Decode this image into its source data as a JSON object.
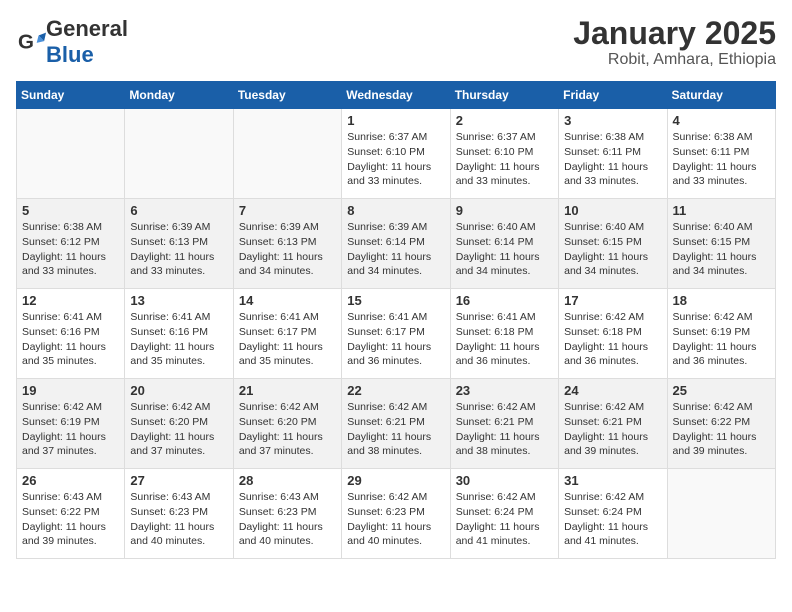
{
  "logo": {
    "general": "General",
    "blue": "Blue"
  },
  "title": "January 2025",
  "subtitle": "Robit, Amhara, Ethiopia",
  "days_of_week": [
    "Sunday",
    "Monday",
    "Tuesday",
    "Wednesday",
    "Thursday",
    "Friday",
    "Saturday"
  ],
  "weeks": [
    [
      {
        "day": "",
        "info": ""
      },
      {
        "day": "",
        "info": ""
      },
      {
        "day": "",
        "info": ""
      },
      {
        "day": "1",
        "info": "Sunrise: 6:37 AM\nSunset: 6:10 PM\nDaylight: 11 hours\nand 33 minutes."
      },
      {
        "day": "2",
        "info": "Sunrise: 6:37 AM\nSunset: 6:10 PM\nDaylight: 11 hours\nand 33 minutes."
      },
      {
        "day": "3",
        "info": "Sunrise: 6:38 AM\nSunset: 6:11 PM\nDaylight: 11 hours\nand 33 minutes."
      },
      {
        "day": "4",
        "info": "Sunrise: 6:38 AM\nSunset: 6:11 PM\nDaylight: 11 hours\nand 33 minutes."
      }
    ],
    [
      {
        "day": "5",
        "info": "Sunrise: 6:38 AM\nSunset: 6:12 PM\nDaylight: 11 hours\nand 33 minutes."
      },
      {
        "day": "6",
        "info": "Sunrise: 6:39 AM\nSunset: 6:13 PM\nDaylight: 11 hours\nand 33 minutes."
      },
      {
        "day": "7",
        "info": "Sunrise: 6:39 AM\nSunset: 6:13 PM\nDaylight: 11 hours\nand 34 minutes."
      },
      {
        "day": "8",
        "info": "Sunrise: 6:39 AM\nSunset: 6:14 PM\nDaylight: 11 hours\nand 34 minutes."
      },
      {
        "day": "9",
        "info": "Sunrise: 6:40 AM\nSunset: 6:14 PM\nDaylight: 11 hours\nand 34 minutes."
      },
      {
        "day": "10",
        "info": "Sunrise: 6:40 AM\nSunset: 6:15 PM\nDaylight: 11 hours\nand 34 minutes."
      },
      {
        "day": "11",
        "info": "Sunrise: 6:40 AM\nSunset: 6:15 PM\nDaylight: 11 hours\nand 34 minutes."
      }
    ],
    [
      {
        "day": "12",
        "info": "Sunrise: 6:41 AM\nSunset: 6:16 PM\nDaylight: 11 hours\nand 35 minutes."
      },
      {
        "day": "13",
        "info": "Sunrise: 6:41 AM\nSunset: 6:16 PM\nDaylight: 11 hours\nand 35 minutes."
      },
      {
        "day": "14",
        "info": "Sunrise: 6:41 AM\nSunset: 6:17 PM\nDaylight: 11 hours\nand 35 minutes."
      },
      {
        "day": "15",
        "info": "Sunrise: 6:41 AM\nSunset: 6:17 PM\nDaylight: 11 hours\nand 36 minutes."
      },
      {
        "day": "16",
        "info": "Sunrise: 6:41 AM\nSunset: 6:18 PM\nDaylight: 11 hours\nand 36 minutes."
      },
      {
        "day": "17",
        "info": "Sunrise: 6:42 AM\nSunset: 6:18 PM\nDaylight: 11 hours\nand 36 minutes."
      },
      {
        "day": "18",
        "info": "Sunrise: 6:42 AM\nSunset: 6:19 PM\nDaylight: 11 hours\nand 36 minutes."
      }
    ],
    [
      {
        "day": "19",
        "info": "Sunrise: 6:42 AM\nSunset: 6:19 PM\nDaylight: 11 hours\nand 37 minutes."
      },
      {
        "day": "20",
        "info": "Sunrise: 6:42 AM\nSunset: 6:20 PM\nDaylight: 11 hours\nand 37 minutes."
      },
      {
        "day": "21",
        "info": "Sunrise: 6:42 AM\nSunset: 6:20 PM\nDaylight: 11 hours\nand 37 minutes."
      },
      {
        "day": "22",
        "info": "Sunrise: 6:42 AM\nSunset: 6:21 PM\nDaylight: 11 hours\nand 38 minutes."
      },
      {
        "day": "23",
        "info": "Sunrise: 6:42 AM\nSunset: 6:21 PM\nDaylight: 11 hours\nand 38 minutes."
      },
      {
        "day": "24",
        "info": "Sunrise: 6:42 AM\nSunset: 6:21 PM\nDaylight: 11 hours\nand 39 minutes."
      },
      {
        "day": "25",
        "info": "Sunrise: 6:42 AM\nSunset: 6:22 PM\nDaylight: 11 hours\nand 39 minutes."
      }
    ],
    [
      {
        "day": "26",
        "info": "Sunrise: 6:43 AM\nSunset: 6:22 PM\nDaylight: 11 hours\nand 39 minutes."
      },
      {
        "day": "27",
        "info": "Sunrise: 6:43 AM\nSunset: 6:23 PM\nDaylight: 11 hours\nand 40 minutes."
      },
      {
        "day": "28",
        "info": "Sunrise: 6:43 AM\nSunset: 6:23 PM\nDaylight: 11 hours\nand 40 minutes."
      },
      {
        "day": "29",
        "info": "Sunrise: 6:42 AM\nSunset: 6:23 PM\nDaylight: 11 hours\nand 40 minutes."
      },
      {
        "day": "30",
        "info": "Sunrise: 6:42 AM\nSunset: 6:24 PM\nDaylight: 11 hours\nand 41 minutes."
      },
      {
        "day": "31",
        "info": "Sunrise: 6:42 AM\nSunset: 6:24 PM\nDaylight: 11 hours\nand 41 minutes."
      },
      {
        "day": "",
        "info": ""
      }
    ]
  ]
}
